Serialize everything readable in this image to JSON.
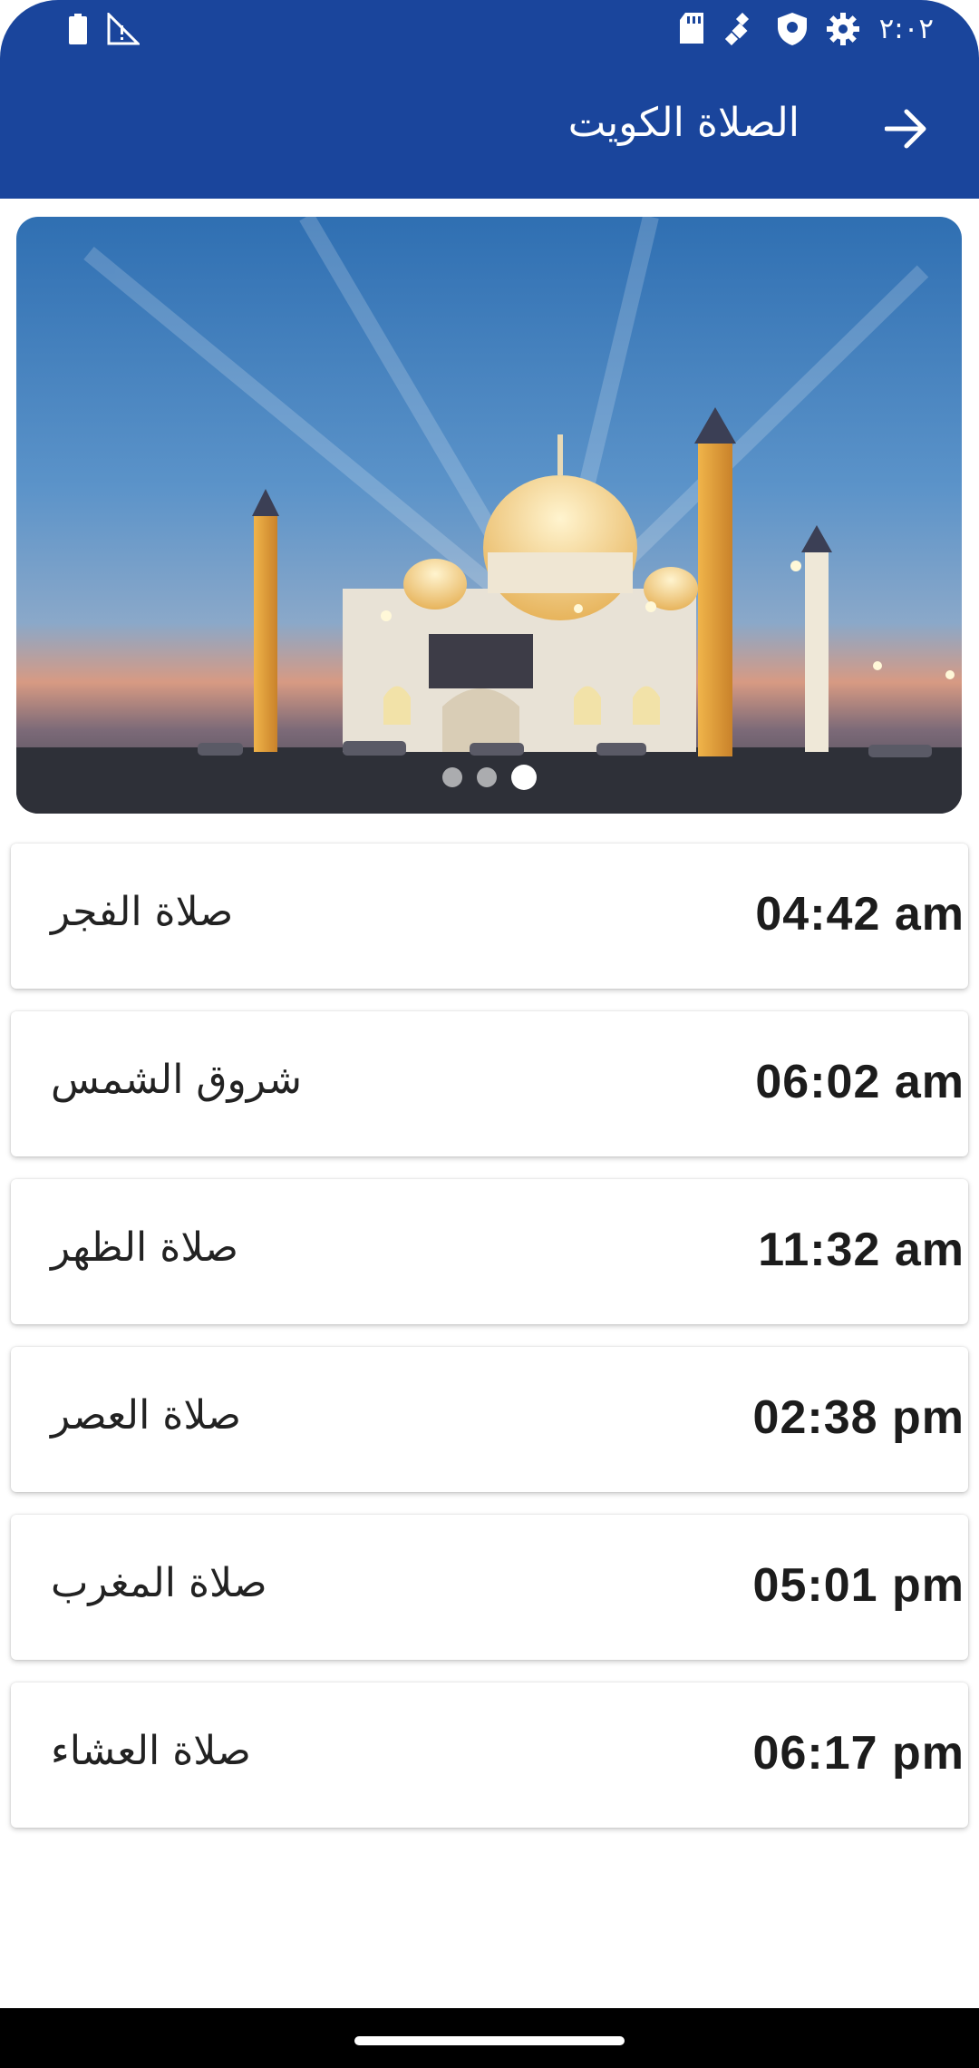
{
  "status_bar": {
    "time": "٢:٠٢",
    "icons": [
      "battery-icon",
      "no-signal-icon",
      "sd-card-icon",
      "satellite-icon",
      "shield-icon",
      "settings-icon"
    ]
  },
  "header": {
    "title": "الصلاة الكويت",
    "back_icon": "arrow-right-icon",
    "background": "#1a459c"
  },
  "carousel": {
    "image": "mosque-photo",
    "page_count": 3,
    "active_page": 3
  },
  "prayers": [
    {
      "name": "صلاة الفجر",
      "time": "04:42 am"
    },
    {
      "name": "شروق الشمس",
      "time": "06:02 am"
    },
    {
      "name": "صلاة الظهر",
      "time": "11:32 am"
    },
    {
      "name": "صلاة العصر",
      "time": "02:38 pm"
    },
    {
      "name": "صلاة المغرب",
      "time": "05:01 pm"
    },
    {
      "name": "صلاة العشاء",
      "time": "06:17 pm"
    }
  ]
}
